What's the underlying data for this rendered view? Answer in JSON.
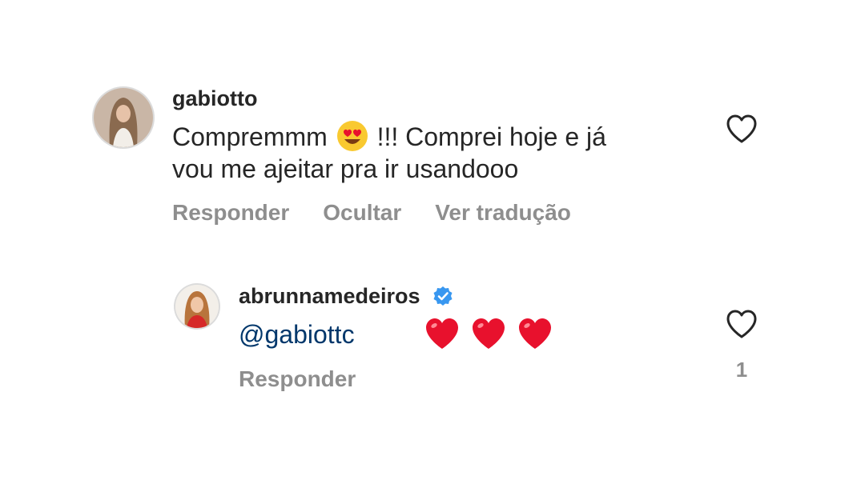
{
  "comments": [
    {
      "username": "gabiotto",
      "text_part1": "Compremmm",
      "emoji": "heart-eyes-emoji",
      "text_part2": "!!! Comprei hoje e já",
      "text_line2": "vou me ajeitar pra ir usandooo",
      "actions": [
        "Responder",
        "Ocultar",
        "Ver tradução"
      ]
    }
  ],
  "reply": {
    "username": "abrunnamedeiros",
    "verified": true,
    "mention": "@gabiottc",
    "hearts": [
      "red-heart-emoji",
      "red-heart-emoji",
      "red-heart-emoji"
    ],
    "action": "Responder",
    "like_count": "1"
  },
  "colors": {
    "text": "#262626",
    "muted": "#8e8e8e",
    "mention": "#00376b",
    "verified": "#3897f0",
    "heart": "#e8112d"
  }
}
